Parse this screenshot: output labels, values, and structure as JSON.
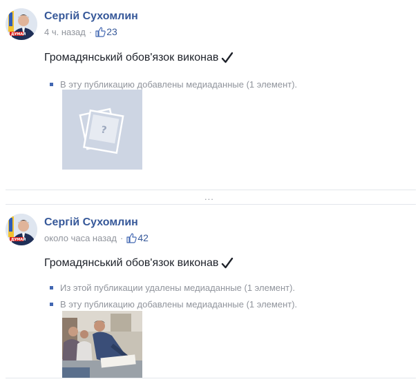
{
  "posts": [
    {
      "author": "Сергій Сухомлин",
      "time": "4 ч. назад",
      "likes": "23",
      "message": "Громадянський обов'язок виконав",
      "media_notes": [
        "В эту публикацию добавлены медиаданные (1 элемент)."
      ],
      "media": {
        "type": "placeholder",
        "icon": "photo-placeholder-icon"
      }
    },
    {
      "author": "Сергій Сухомлин",
      "time": "около часа назад",
      "likes": "42",
      "message": "Громадянський обов'язок виконав",
      "media_notes": [
        "Из этой публикации удалены медиаданные (1 элемент).",
        "В эту публикацию добавлены медиаданные (1 элемент)."
      ],
      "media": {
        "type": "photo"
      }
    }
  ],
  "separator": "...",
  "colors": {
    "author": "#365899",
    "meta": "#90949c",
    "bullet": "#4267b2",
    "placeholder_bg": "#cdd5e3",
    "divider": "#e3e6eb"
  }
}
